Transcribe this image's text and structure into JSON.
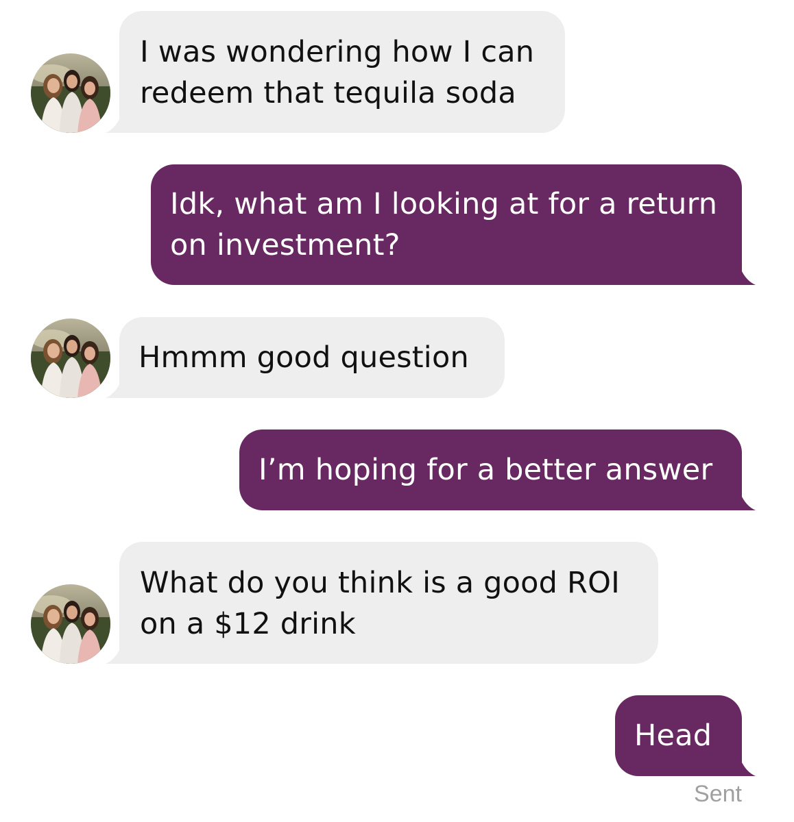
{
  "conversation": {
    "colors": {
      "incoming_bubble": "#eeeeee",
      "outgoing_bubble": "#682861",
      "incoming_text": "#111111",
      "outgoing_text": "#ffffff",
      "status_text": "#a0a0a0"
    },
    "messages": [
      {
        "direction": "incoming",
        "text": "I was wondering how I can\nredeem that tequila soda",
        "avatar_icon": "profile-photo-avatar"
      },
      {
        "direction": "outgoing",
        "text": "Idk, what am I looking at for a return\non investment?"
      },
      {
        "direction": "incoming",
        "text": "Hmmm good question",
        "avatar_icon": "profile-photo-avatar"
      },
      {
        "direction": "outgoing",
        "text": "I’m hoping for a better answer"
      },
      {
        "direction": "incoming",
        "text": "What do you think is a good ROI\non a $12 drink",
        "avatar_icon": "profile-photo-avatar"
      },
      {
        "direction": "outgoing",
        "text": "Head"
      }
    ],
    "delivery_status": "Sent"
  }
}
